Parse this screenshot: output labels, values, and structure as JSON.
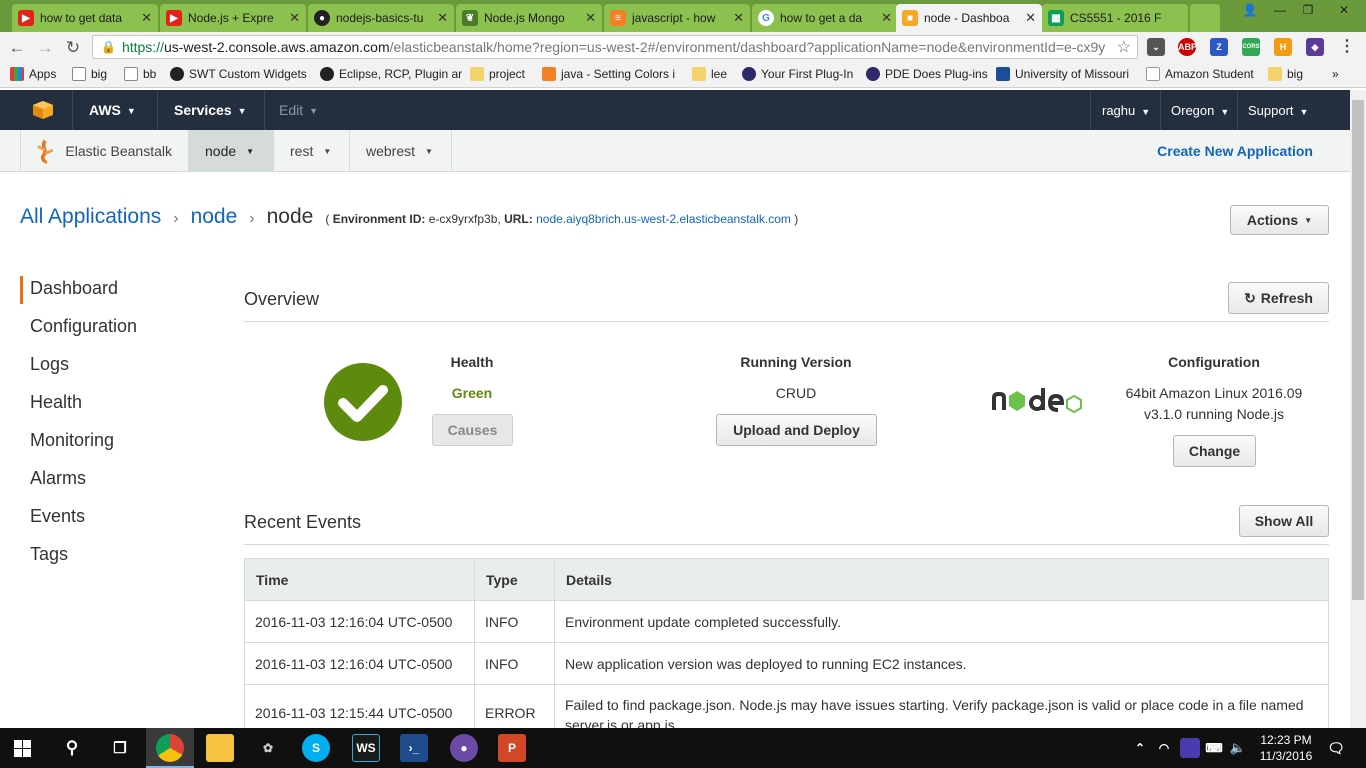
{
  "browser": {
    "tabs": [
      {
        "title": "how to get data",
        "icon": "youtube-icon"
      },
      {
        "title": "Node.js + Expre",
        "icon": "youtube-icon"
      },
      {
        "title": "nodejs-basics-tu",
        "icon": "github-icon"
      },
      {
        "title": "Node.js Mongo",
        "icon": "mongo-leaf-icon"
      },
      {
        "title": "javascript - how",
        "icon": "stackoverflow-icon"
      },
      {
        "title": "how to get a da",
        "icon": "google-icon"
      },
      {
        "title": "node - Dashboa",
        "icon": "aws-cube-icon"
      },
      {
        "title": "CS5551 - 2016 F",
        "icon": "sheets-icon"
      }
    ],
    "user_label": "",
    "url": {
      "scheme": "https://",
      "host": "us-west-2.console.aws.amazon.com",
      "path": "/elasticbeanstalk/home?region=us-west-2#/environment/dashboard?applicationName=node&environmentId=e-cx9y"
    },
    "extensions": [
      "ABP",
      "Z",
      "CORS",
      "H"
    ],
    "bookmarks": [
      {
        "label": "Apps"
      },
      {
        "label": "big"
      },
      {
        "label": "bb"
      },
      {
        "label": "SWT Custom Widgets"
      },
      {
        "label": "Eclipse, RCP, Plugin ar"
      },
      {
        "label": "project"
      },
      {
        "label": "java - Setting Colors i"
      },
      {
        "label": "lee"
      },
      {
        "label": "Your First Plug-In"
      },
      {
        "label": "PDE Does Plug-ins"
      },
      {
        "label": "University of Missouri"
      },
      {
        "label": "Amazon Student"
      },
      {
        "label": "big"
      }
    ],
    "bookmarks_more": "»"
  },
  "aws_nav": {
    "brand": "AWS",
    "services": "Services",
    "edit": "Edit",
    "user": "raghu",
    "region": "Oregon",
    "support": "Support"
  },
  "eb_nav": {
    "service": "Elastic Beanstalk",
    "apps": [
      "node",
      "rest",
      "webrest"
    ],
    "create": "Create New Application"
  },
  "breadcrumb": {
    "all": "All Applications",
    "app": "node",
    "env": "node",
    "env_id_label": "Environment ID:",
    "env_id": "e-cx9yrxfp3b,",
    "url_label": "URL:",
    "url": "node.aiyq8brich.us-west-2.elasticbeanstalk.com",
    "open": "(",
    "close": ")"
  },
  "actions_label": "Actions",
  "sidebar": [
    "Dashboard",
    "Configuration",
    "Logs",
    "Health",
    "Monitoring",
    "Alarms",
    "Events",
    "Tags"
  ],
  "overview": {
    "title": "Overview",
    "refresh": "Refresh",
    "health_head": "Health",
    "health_value": "Green",
    "causes": "Causes",
    "version_head": "Running Version",
    "version_value": "CRUD",
    "deploy": "Upload and Deploy",
    "config_head": "Configuration",
    "config_line1": "64bit Amazon Linux 2016.09",
    "config_line2": "v3.1.0 running Node.js",
    "change": "Change",
    "colors": {
      "health_green": "#5e8a0d"
    }
  },
  "events": {
    "title": "Recent Events",
    "show_all": "Show All",
    "headers": [
      "Time",
      "Type",
      "Details"
    ],
    "rows": [
      {
        "time": "2016-11-03 12:16:04 UTC-0500",
        "type": "INFO",
        "details": "Environment update completed successfully."
      },
      {
        "time": "2016-11-03 12:16:04 UTC-0500",
        "type": "INFO",
        "details": "New application version was deployed to running EC2 instances."
      },
      {
        "time": "2016-11-03 12:15:44 UTC-0500",
        "type": "ERROR",
        "details": "Failed to find package.json. Node.js may have issues starting. Verify package.json is valid or place code in a file named server.js or app.js."
      }
    ]
  },
  "taskbar": {
    "time": "12:23 PM",
    "date": "11/3/2016"
  }
}
